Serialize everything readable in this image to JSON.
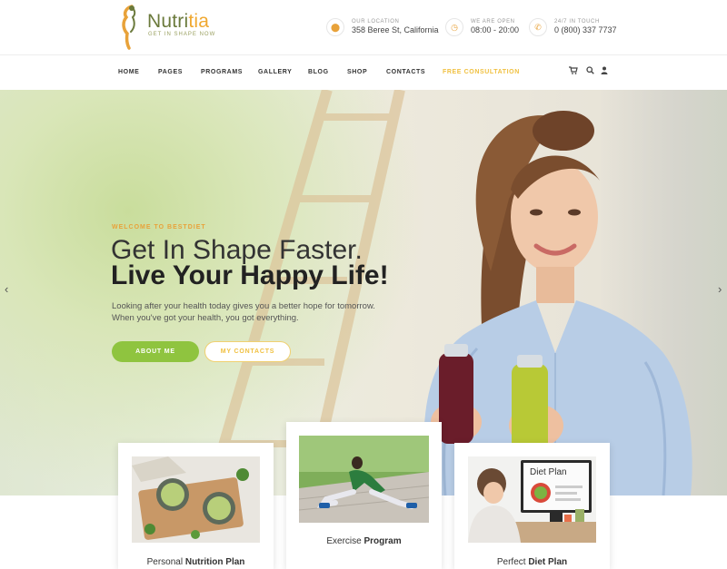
{
  "brand": {
    "name_main": "Nutri",
    "name_accent": "tia",
    "tagline": "GET IN SHAPE NOW"
  },
  "header_info": [
    {
      "label": "OUR LOCATION",
      "value": "358 Beree St, California",
      "icon": "location-pin-icon"
    },
    {
      "label": "WE ARE OPEN",
      "value": "08:00 - 20:00",
      "icon": "clock-icon"
    },
    {
      "label": "24/7 IN TOUCH",
      "value": "0 (800) 337 7737",
      "icon": "phone-icon"
    }
  ],
  "nav": {
    "items": [
      "HOME",
      "PAGES",
      "PROGRAMS",
      "GALLERY",
      "BLOG",
      "SHOP",
      "CONTACTS",
      "FREE CONSULTATION"
    ],
    "icons": [
      "cart-icon",
      "search-icon",
      "user-icon"
    ]
  },
  "hero": {
    "kicker": "WELCOME TO BESTDIET",
    "headline_1": "Get In Shape Faster.",
    "headline_2": "Live Your Happy Life!",
    "text_1": "Looking after your health today gives you a better hope for tomorrow.",
    "text_2": "When you've got your health, you got everything.",
    "btn_primary": "ABOUT ME",
    "btn_secondary": "MY CONTACTS",
    "prev_arrow": "‹",
    "next_arrow": "›"
  },
  "cards": [
    {
      "title_plain": "Personal ",
      "title_bold": "Nutrition Plan"
    },
    {
      "title_plain": "Exercise ",
      "title_bold": "Program"
    },
    {
      "title_plain": "Perfect ",
      "title_bold": "Diet Plan"
    }
  ],
  "card3_screen_text": "Diet Plan",
  "colors": {
    "accent_green": "#8fc43f",
    "accent_yellow": "#f0c040",
    "accent_orange": "#e8a23a",
    "text_dark": "#222222"
  }
}
